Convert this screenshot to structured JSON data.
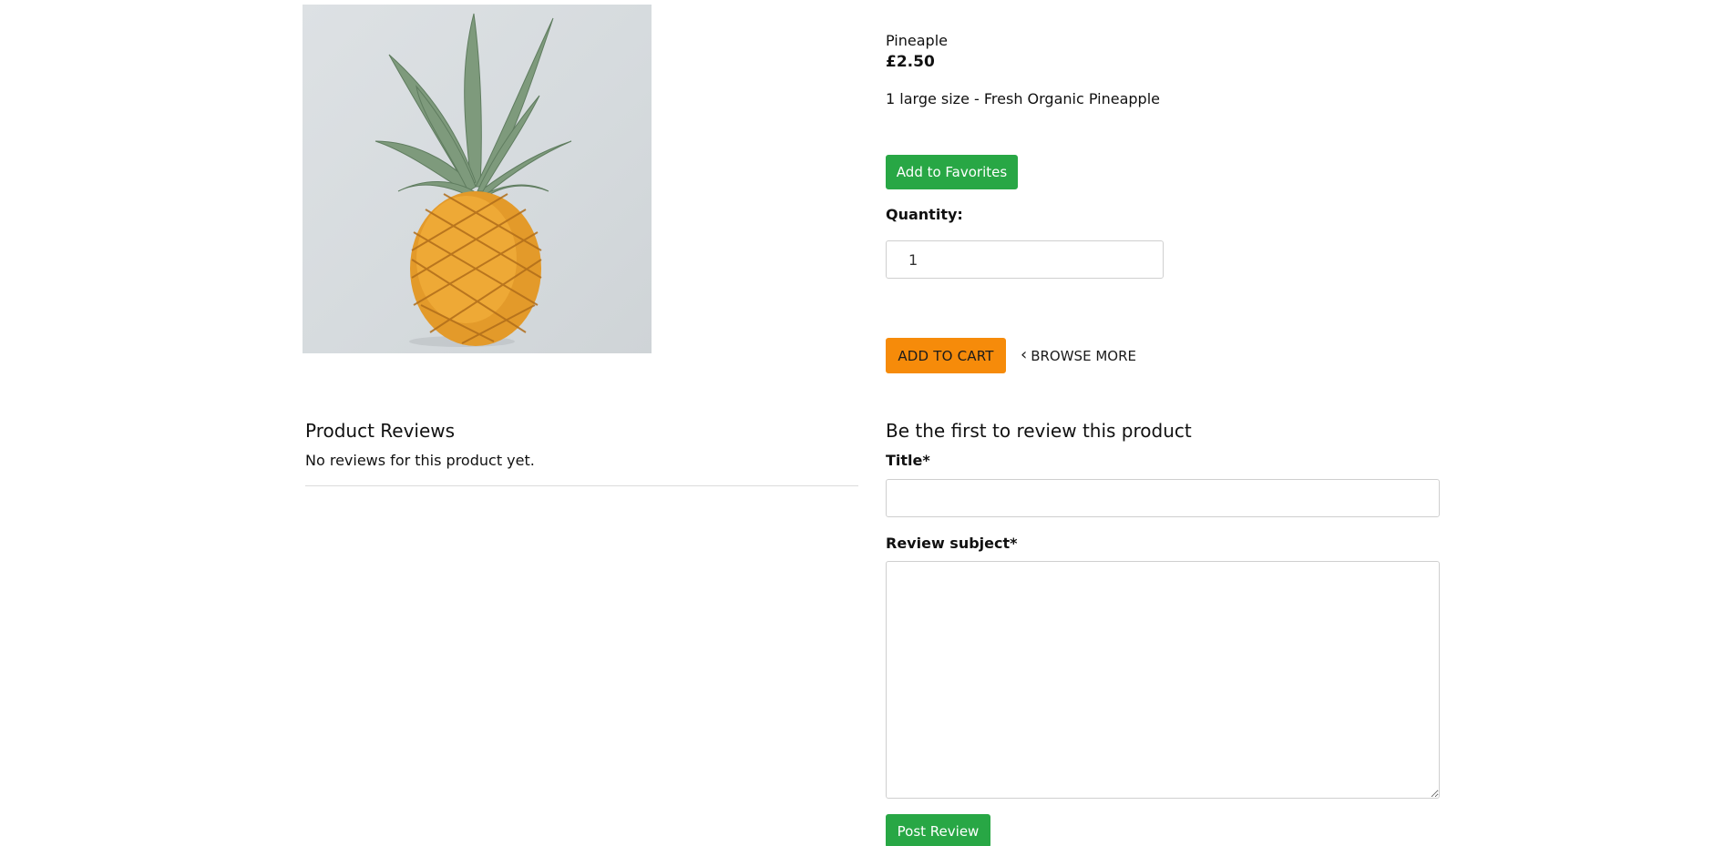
{
  "product": {
    "name": "Pineaple",
    "price": "£2.50",
    "description": "1 large size - Fresh Organic Pineapple",
    "image_alt": "Pineapple"
  },
  "actions": {
    "favorites_label": "Add to Favorites",
    "quantity_label": "Quantity:",
    "quantity_value": "1",
    "add_to_cart_label": "ADD TO CART",
    "browse_more_label": "BROWSE MORE",
    "browse_more_icon": "chevron-left-icon"
  },
  "reviews": {
    "title": "Product Reviews",
    "empty_text": "No reviews for this product yet."
  },
  "review_form": {
    "title": "Be the first to review this product",
    "title_label": "Title*",
    "title_value": "",
    "subject_label": "Review subject*",
    "subject_value": "",
    "submit_label": "Post Review"
  },
  "colors": {
    "green": "#28a745",
    "orange": "#f68b0a",
    "image_background": "#dde1e4"
  }
}
